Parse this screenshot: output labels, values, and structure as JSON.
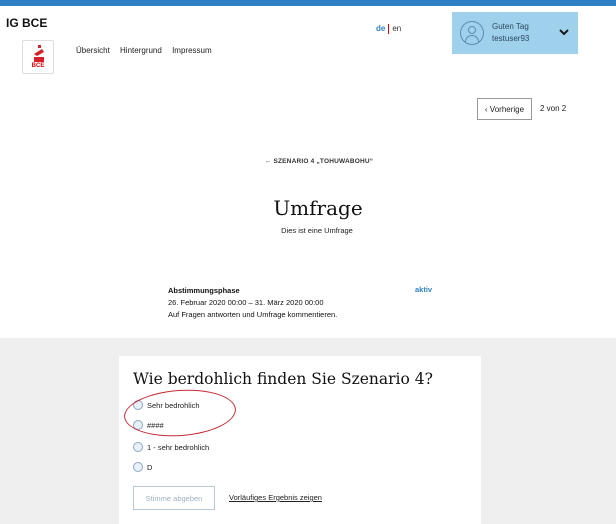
{
  "brand": {
    "name": "IG BCE",
    "logo_text": "BCE",
    "logo_color": "#d61f26"
  },
  "nav": {
    "items": [
      "Übersicht",
      "Hintergrund",
      "Impressum"
    ]
  },
  "language": {
    "active": "de",
    "other": "en"
  },
  "user": {
    "greeting": "Guten Tag",
    "username": "testuser93"
  },
  "pagination": {
    "prev_label": "‹ Vorherige",
    "count": "2 von 2"
  },
  "scenario_link": "← SZENARIO 4 „TOHUWABOHU“",
  "page": {
    "title": "Umfrage",
    "subtitle": "Dies ist eine Umfrage"
  },
  "phase": {
    "title": "Abstimmungsphase",
    "dates": "26. Februar 2020 00:00 – 31. März 2020 00:00",
    "description": "Auf Fragen antworten und Umfrage kommentieren.",
    "status": "aktiv"
  },
  "poll": {
    "question": "Wie berdohlich finden Sie Szenario 4?",
    "options": [
      "Sehr bedrohlich",
      "####",
      "1 - sehr bedrohlich",
      "D"
    ],
    "submit_label": "Stimme abgeben",
    "results_link": "Vorläufiges Ergebnis zeigen"
  },
  "colors": {
    "accent": "#2f7fc4",
    "user_box": "#9fd0ec",
    "annotation": "#c32c35"
  }
}
